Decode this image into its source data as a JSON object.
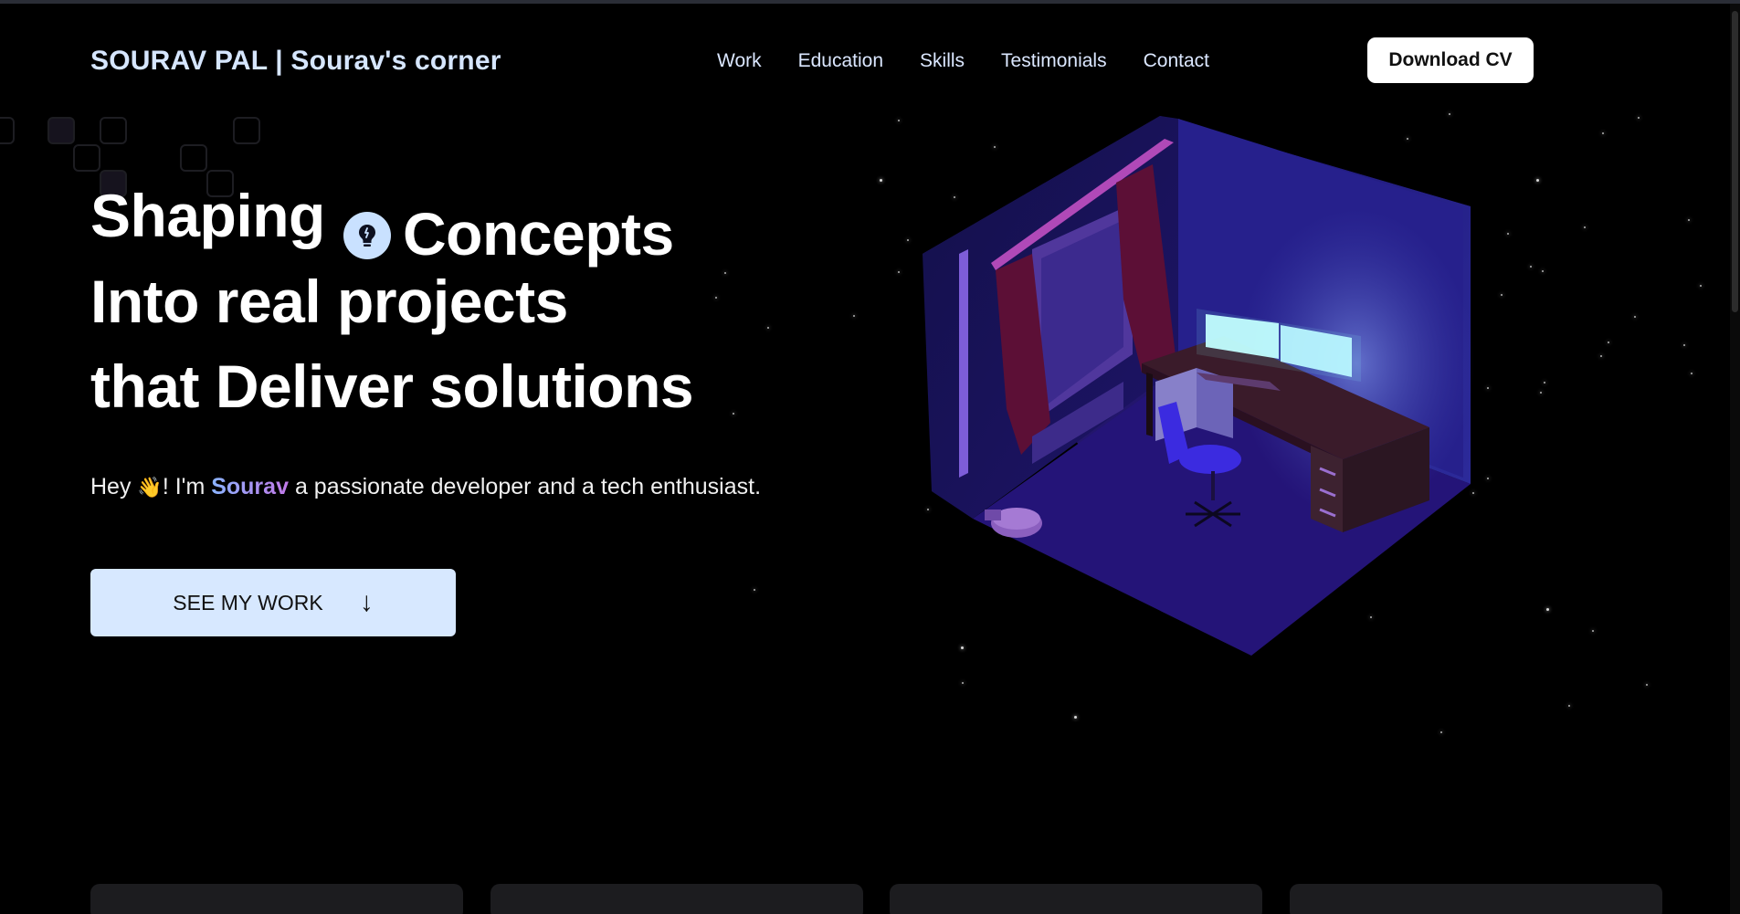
{
  "header": {
    "brand": "SOURAV PAL | Sourav's corner",
    "nav": [
      "Work",
      "Education",
      "Skills",
      "Testimonials",
      "Contact"
    ],
    "cv_button": "Download CV"
  },
  "hero": {
    "line1_a": "Shaping",
    "line1_b": "Concepts",
    "line2": "Into real projects",
    "line3": "that Deliver solutions",
    "icon": "lightbulb-icon",
    "intro_prefix": "Hey",
    "intro_wave": "👋",
    "intro_mid": "! I'm",
    "intro_name": "Sourav",
    "intro_suffix": "a passionate developer and a tech enthusiast.",
    "cta_label": "SEE MY WORK",
    "cta_arrow": "↓"
  },
  "colors": {
    "background": "#000000",
    "brand_text": "#d6e6ff",
    "cta_bg": "#d7e8ff",
    "accent_gradient": [
      "#8ab4ff",
      "#c179e8"
    ]
  }
}
